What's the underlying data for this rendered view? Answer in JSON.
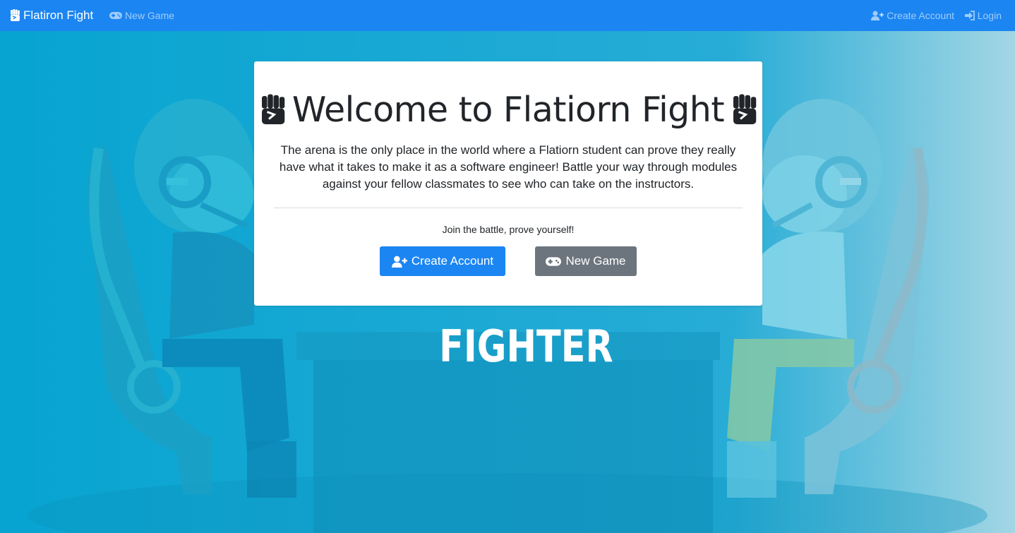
{
  "navbar": {
    "brand_icon": "fist-icon",
    "brand": "Flatiron Fight",
    "new_game_icon": "gamepad-icon",
    "new_game": "New Game",
    "create_account_icon": "user-plus-icon",
    "create_account": "Create Account",
    "login_icon": "sign-in-icon",
    "login": "Login"
  },
  "hero": {
    "title": "Welcome to Flatiorn Fight",
    "title_icon": "fist-icon",
    "lead": "The arena is the only place in the world where a Flatiorn student can prove they really have what it takes to make it as a software engineer! Battle your way through modules against your fellow classmates to see who can take on the instructors.",
    "tagline": "Join the battle, prove yourself!",
    "create_button": "Create Account",
    "new_game_button": "New Game"
  },
  "background": {
    "logo_text": "FIGHTER",
    "colors": {
      "navbar": "#1b85f2",
      "primary_button": "#1b85f2",
      "secondary_button": "#6c757d",
      "backdrop": "#1aa3cf"
    }
  }
}
